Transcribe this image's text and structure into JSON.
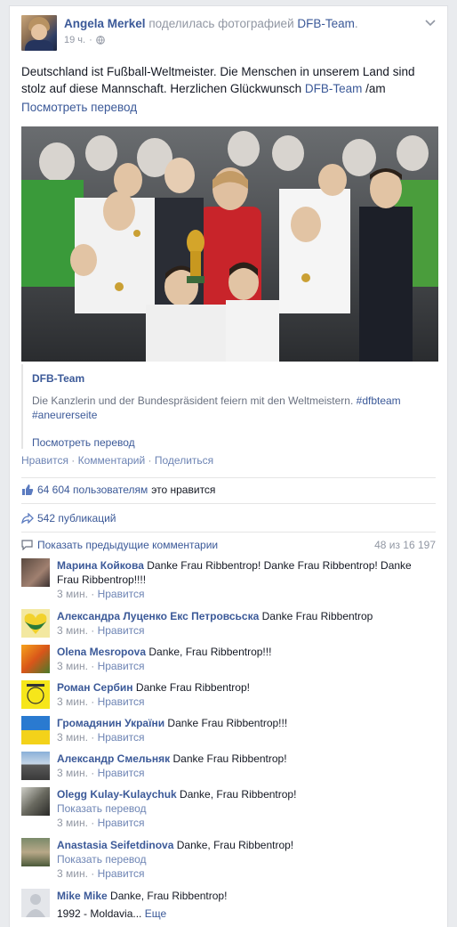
{
  "post": {
    "author": "Angela Merkel",
    "action_text": "поделилась фотографией",
    "shared_from": "DFB-Team",
    "shared_suffix": ".",
    "time": "19 ч.",
    "text_main": "Deutschland ist Fußball-Weltmeister. Die Menschen in unserem Land sind stolz auf diese Mannschaft. Herzlichen Glückwunsch ",
    "text_link": "DFB-Team",
    "text_tail": " /am",
    "see_translation": "Посмотреть перевод"
  },
  "attachment": {
    "title": "DFB-Team",
    "description_text": "Die Kanzlerin und der Bundespräsident feiern mit den Weltmeistern. ",
    "hashtag1": "#dfbteam",
    "hashtag2": "#aneurerseite",
    "see_translation": "Посмотреть перевод"
  },
  "actions": {
    "like": "Нравится",
    "comment": "Комментарий",
    "share": "Поделиться",
    "separator": " · "
  },
  "likes": {
    "count": "64 604 пользователям",
    "suffix": "это нравится"
  },
  "shares": {
    "count": "542 публикаций"
  },
  "comments_header": {
    "show_previous": "Показать предыдущие комментарии",
    "counter": "48 из 16 197"
  },
  "comments": [
    {
      "author": "Марина Койкова",
      "text": " Danke Frau Ribbentrop! Danke Frau Ribbentrop! Danke Frau Ribbentrop!!!!",
      "time": "3 мин.",
      "like": "Нравится",
      "translate": ""
    },
    {
      "author": "Александра Луценко Екс Петровсьска",
      "text": " Danke Frau Ribbentrop",
      "time": "3 мин.",
      "like": "Нравится",
      "translate": ""
    },
    {
      "author": "Olena Mesropova",
      "text": " Danke, Frau Ribbentrop!!!",
      "time": "3 мин.",
      "like": "Нравится",
      "translate": ""
    },
    {
      "author": "Роман Сербин",
      "text": " Danke Frau Ribbentrop!",
      "time": "3 мин.",
      "like": "Нравится",
      "translate": ""
    },
    {
      "author": "Громадянин України",
      "text": " Danke Frau Ribbentrop!!!",
      "time": "3 мин.",
      "like": "Нравится",
      "translate": ""
    },
    {
      "author": "Александр Смельняк",
      "text": " Danke Frau Ribbentrop!",
      "time": "3 мин.",
      "like": "Нравится",
      "translate": ""
    },
    {
      "author": "Olegg Kulay-Kulaychuk",
      "text": " Danke, Frau Ribbentrop!",
      "time": "3 мин.",
      "like": "Нравится",
      "translate": "Показать перевод"
    },
    {
      "author": "Anastasia Seifetdinova",
      "text": " Danke, Frau Ribbentrop!",
      "time": "3 мин.",
      "like": "Нравится",
      "translate": "Показать перевод"
    },
    {
      "author": "Mike Mike",
      "text": " Danke, Frau Ribbentrop!",
      "extra": "1992 - Moldavia...",
      "more": "Еще"
    }
  ],
  "colors": {
    "link": "#3b5998",
    "muted": "#9197a3",
    "background": "#e9ebee"
  }
}
